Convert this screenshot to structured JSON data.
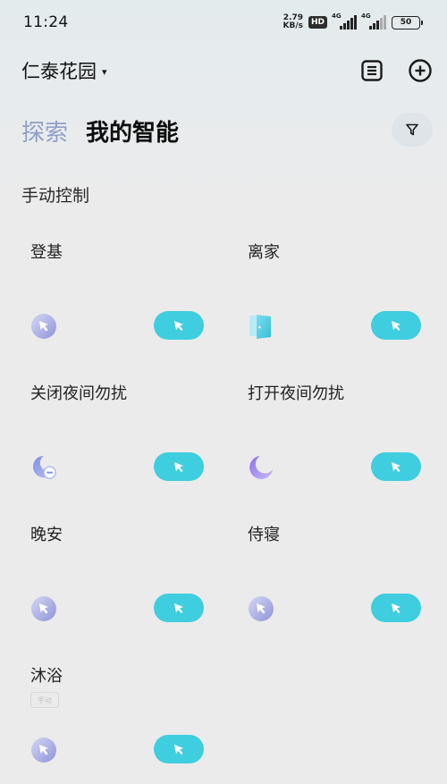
{
  "status": {
    "time": "11:24",
    "speed_value": "2.79",
    "speed_unit": "KB/s",
    "hd_badge": "HD",
    "signal1_label": "4G",
    "signal2_label": "4G",
    "battery": "50"
  },
  "header": {
    "home_name": "仁泰花园",
    "caret": "▾"
  },
  "tabs": {
    "explore": "探索",
    "mine": "我的智能"
  },
  "section": {
    "title": "手动控制"
  },
  "scenes": [
    {
      "name": "登基",
      "icon": "cursor-circle-icon"
    },
    {
      "name": "离家",
      "icon": "door-icon"
    },
    {
      "name": "关闭夜间勿扰",
      "icon": "moon-off-icon"
    },
    {
      "name": "打开夜间勿扰",
      "icon": "moon-icon"
    },
    {
      "name": "晚安",
      "icon": "cursor-circle-icon"
    },
    {
      "name": "侍寝",
      "icon": "cursor-circle-icon"
    },
    {
      "name": "沐浴",
      "icon": "cursor-circle-icon",
      "tag": "手动"
    }
  ],
  "colors": {
    "accent": "#3fcde0",
    "explore_tab": "#8fa0c8",
    "icon_purple": "#a7a9e6"
  }
}
